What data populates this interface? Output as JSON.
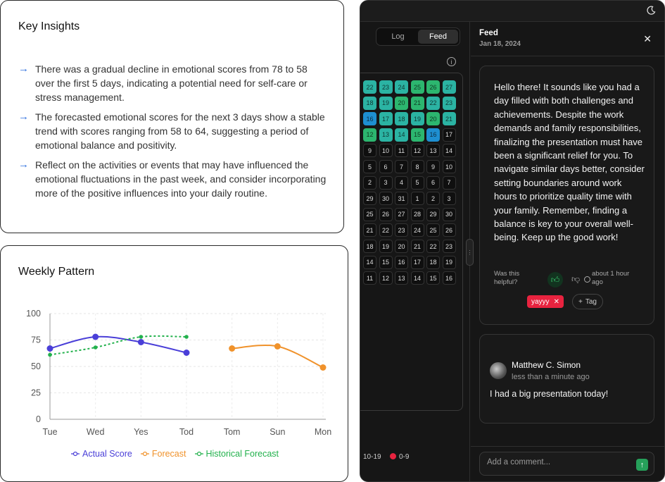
{
  "insights": {
    "title": "Key Insights",
    "items": [
      "There was a gradual decline in emotional scores from 78 to 58 over the first 5 days, indicating a potential need for self-care or stress management.",
      "The forecasted emotional scores for the next 3 days show a stable trend with scores ranging from 58 to 64, suggesting a period of emotional balance and positivity.",
      "Reflect on the activities or events that may have influenced the emotional fluctuations in the past week, and consider incorporating more of the positive influences into your daily routine."
    ]
  },
  "weekly": {
    "title": "Weekly Pattern"
  },
  "chart_data": {
    "type": "line",
    "categories": [
      "Tue",
      "Wed",
      "Yes",
      "Tod",
      "Tom",
      "Sun",
      "Mon"
    ],
    "ylim": [
      0,
      100
    ],
    "yticks": [
      0,
      25,
      50,
      75,
      100
    ],
    "grid": true,
    "legend_position": "bottom",
    "series": [
      {
        "name": "Actual Score",
        "color": "#4a3fd8",
        "style": "solid",
        "values": [
          67,
          78,
          73,
          63,
          null,
          null,
          null
        ]
      },
      {
        "name": "Forecast",
        "color": "#f0922b",
        "style": "solid",
        "values": [
          null,
          null,
          null,
          null,
          67,
          69,
          49
        ]
      },
      {
        "name": "Historical Forecast",
        "color": "#22b14c",
        "style": "dashed",
        "values": [
          61,
          68,
          78,
          78,
          null,
          null,
          null
        ]
      }
    ]
  },
  "panel": {
    "tabs": {
      "log": "Log",
      "feed": "Feed"
    },
    "info_icon": "i",
    "calendar_rows": [
      [
        [
          "22",
          "c1"
        ],
        [
          "23",
          "c1"
        ],
        [
          "24",
          "c1"
        ],
        [
          "25",
          "c3"
        ],
        [
          "26",
          "c3"
        ],
        [
          "27",
          "c1"
        ]
      ],
      [
        [
          "18",
          "c1"
        ],
        [
          "19",
          "c1"
        ],
        [
          "20",
          "c3"
        ],
        [
          "21",
          "c3"
        ],
        [
          "22",
          "c1"
        ],
        [
          "23",
          "c1"
        ]
      ],
      [
        [
          "16",
          "c4"
        ],
        [
          "17",
          "c1"
        ],
        [
          "18",
          "c1"
        ],
        [
          "19",
          "c1"
        ],
        [
          "20",
          "c3"
        ],
        [
          "21",
          "c1"
        ]
      ],
      [
        [
          "12",
          "c3"
        ],
        [
          "13",
          "c1"
        ],
        [
          "14",
          "c1"
        ],
        [
          "15",
          "c3"
        ],
        [
          "16",
          "c4"
        ],
        [
          "17",
          ""
        ]
      ],
      [
        [
          "9",
          ""
        ],
        [
          "10",
          ""
        ],
        [
          "11",
          ""
        ],
        [
          "12",
          ""
        ],
        [
          "13",
          ""
        ],
        [
          "14",
          ""
        ]
      ],
      [
        [
          "5",
          ""
        ],
        [
          "6",
          ""
        ],
        [
          "7",
          ""
        ],
        [
          "8",
          ""
        ],
        [
          "9",
          ""
        ],
        [
          "10",
          ""
        ]
      ],
      [
        [
          "2",
          ""
        ],
        [
          "3",
          ""
        ],
        [
          "4",
          ""
        ],
        [
          "5",
          ""
        ],
        [
          "6",
          ""
        ],
        [
          "7",
          ""
        ]
      ],
      [
        [
          "29",
          ""
        ],
        [
          "30",
          ""
        ],
        [
          "31",
          ""
        ],
        [
          "1",
          ""
        ],
        [
          "2",
          ""
        ],
        [
          "3",
          ""
        ]
      ],
      [
        [
          "25",
          ""
        ],
        [
          "26",
          ""
        ],
        [
          "27",
          ""
        ],
        [
          "28",
          ""
        ],
        [
          "29",
          ""
        ],
        [
          "30",
          ""
        ]
      ],
      [
        [
          "21",
          ""
        ],
        [
          "22",
          ""
        ],
        [
          "23",
          ""
        ],
        [
          "24",
          ""
        ],
        [
          "25",
          ""
        ],
        [
          "26",
          ""
        ]
      ],
      [
        [
          "18",
          ""
        ],
        [
          "19",
          ""
        ],
        [
          "20",
          ""
        ],
        [
          "21",
          ""
        ],
        [
          "22",
          ""
        ],
        [
          "23",
          ""
        ]
      ],
      [
        [
          "14",
          ""
        ],
        [
          "15",
          ""
        ],
        [
          "16",
          ""
        ],
        [
          "17",
          ""
        ],
        [
          "18",
          ""
        ],
        [
          "19",
          ""
        ]
      ],
      [
        [
          "11",
          ""
        ],
        [
          "12",
          ""
        ],
        [
          "13",
          ""
        ],
        [
          "14",
          ""
        ],
        [
          "15",
          ""
        ],
        [
          "16",
          ""
        ]
      ]
    ],
    "legend": {
      "range1": "10-19",
      "range2": "0-9",
      "range2_color": "#e8233f"
    }
  },
  "feed": {
    "title": "Feed",
    "date": "Jan 18, 2024",
    "close": "✕",
    "ai_message": "Hello there! It sounds like you had a day filled with both challenges and achievements. Despite the work demands and family responsibilities, finalizing the presentation must have been a significant relief for you. To navigate similar days better, consider setting boundaries around work hours to prioritize quality time with your family. Remember, finding a balance is key to your overall well-being. Keep up the good work!",
    "helpful_label": "Was this helpful?",
    "time_ago": "about 1 hour ago",
    "tag": "yayyy",
    "tag_remove": "✕",
    "add_tag": "Tag",
    "comment": {
      "author": "Matthew C. Simon",
      "time": "less than a minute ago",
      "text": "I had a big presentation today!"
    },
    "input_placeholder": "Add a comment..."
  }
}
